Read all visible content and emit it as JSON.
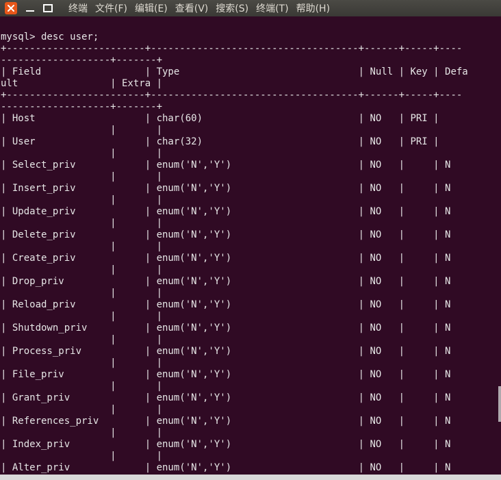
{
  "window": {
    "menu": [
      "终端",
      "文件(F)",
      "编辑(E)",
      "查看(V)",
      "搜索(S)",
      "终端(T)",
      "帮助(H)"
    ]
  },
  "terminal": {
    "lines": [
      "",
      "mysql> desc user;",
      "+------------------------+------------------------------------+------+-----+----",
      "-------------------+-------+",
      "| Field                  | Type                               | Null | Key | Defa",
      "ult                | Extra |",
      "+------------------------+------------------------------------+------+-----+----",
      "-------------------+-------+",
      "| Host                   | char(60)                           | NO   | PRI |",
      "                   |       |",
      "| User                   | char(32)                           | NO   | PRI |",
      "                   |       |",
      "| Select_priv            | enum('N','Y')                      | NO   |     | N",
      "                   |       |",
      "| Insert_priv            | enum('N','Y')                      | NO   |     | N",
      "                   |       |",
      "| Update_priv            | enum('N','Y')                      | NO   |     | N",
      "                   |       |",
      "| Delete_priv            | enum('N','Y')                      | NO   |     | N",
      "                   |       |",
      "| Create_priv            | enum('N','Y')                      | NO   |     | N",
      "                   |       |",
      "| Drop_priv              | enum('N','Y')                      | NO   |     | N",
      "                   |       |",
      "| Reload_priv            | enum('N','Y')                      | NO   |     | N",
      "                   |       |",
      "| Shutdown_priv          | enum('N','Y')                      | NO   |     | N",
      "                   |       |",
      "| Process_priv           | enum('N','Y')                      | NO   |     | N",
      "                   |       |",
      "| File_priv              | enum('N','Y')                      | NO   |     | N",
      "                   |       |",
      "| Grant_priv             | enum('N','Y')                      | NO   |     | N",
      "                   |       |",
      "| References_priv        | enum('N','Y')                      | NO   |     | N",
      "                   |       |",
      "| Index_priv             | enum('N','Y')                      | NO   |     | N",
      "                   |       |",
      "| Alter_priv             | enum('N','Y')                      | NO   |     | N"
    ]
  }
}
